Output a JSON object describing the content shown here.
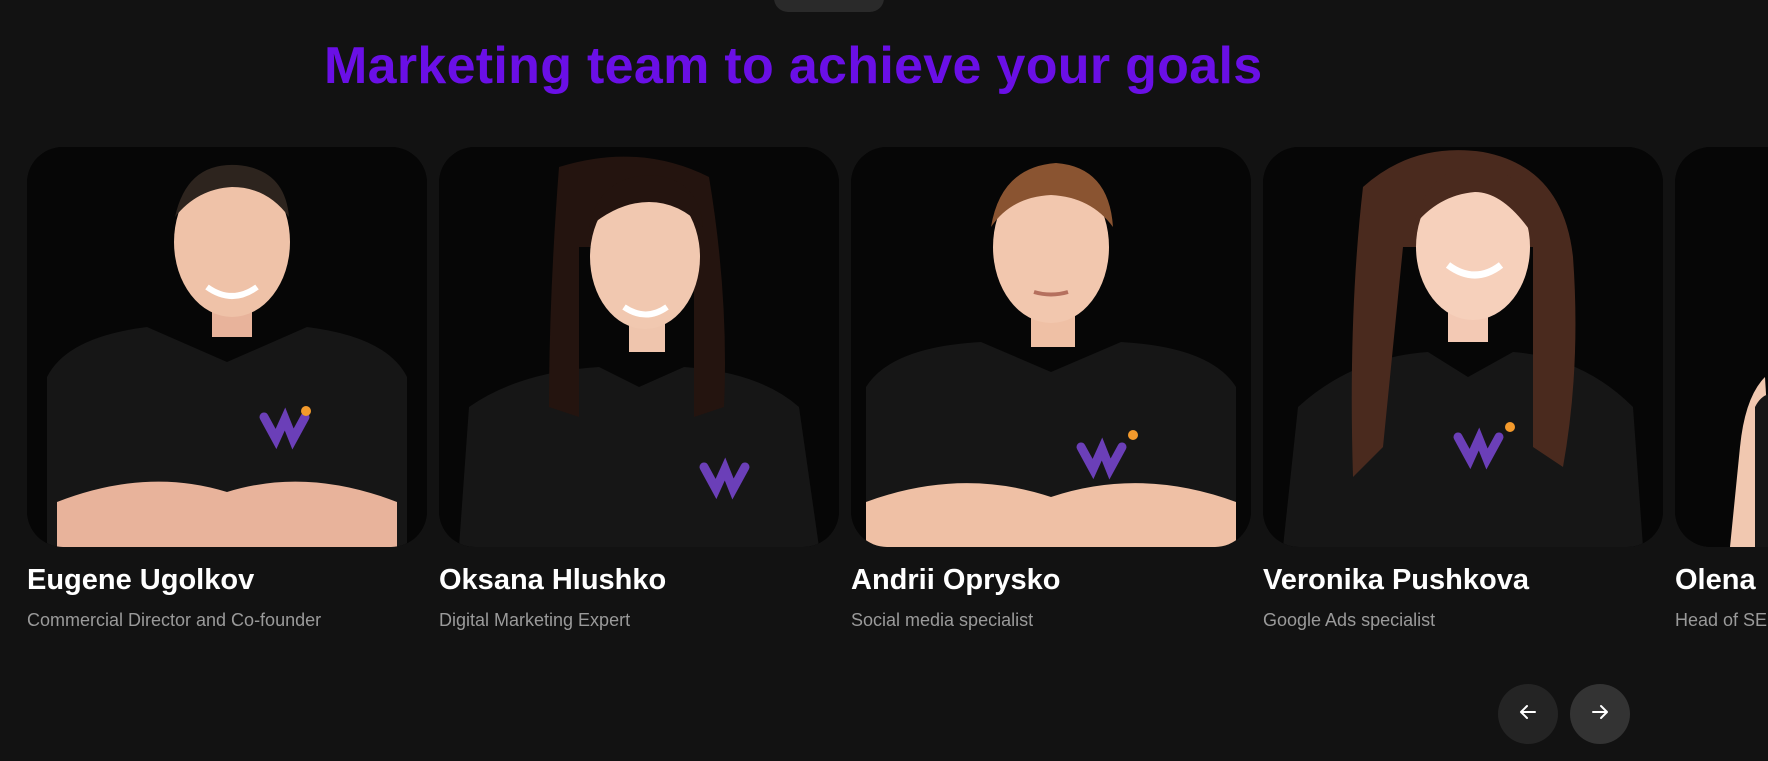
{
  "heading": "Marketing team to achieve your goals",
  "team": [
    {
      "name": "Eugene Ugolkov",
      "role": "Commercial Director and Co-founder",
      "shirt_logo": "wi-logo"
    },
    {
      "name": "Oksana Hlushko",
      "role": "Digital Marketing Expert",
      "shirt_logo": "wi-logo"
    },
    {
      "name": "Andrii Oprysko",
      "role": "Social media specialist",
      "shirt_logo": "wi-logo"
    },
    {
      "name": "Veronika Pushkova",
      "role": "Google Ads specialist",
      "shirt_logo": "wi-logo"
    },
    {
      "name": "Olena",
      "role": "Head of SE",
      "shirt_logo": "wi-logo"
    }
  ],
  "nav": {
    "prev_icon": "arrow-left-icon",
    "next_icon": "arrow-right-icon"
  },
  "colors": {
    "background": "#121212",
    "accent": "#6a0fe6",
    "logo_purple": "#6b3fb8",
    "logo_dot": "#f39a2c"
  }
}
